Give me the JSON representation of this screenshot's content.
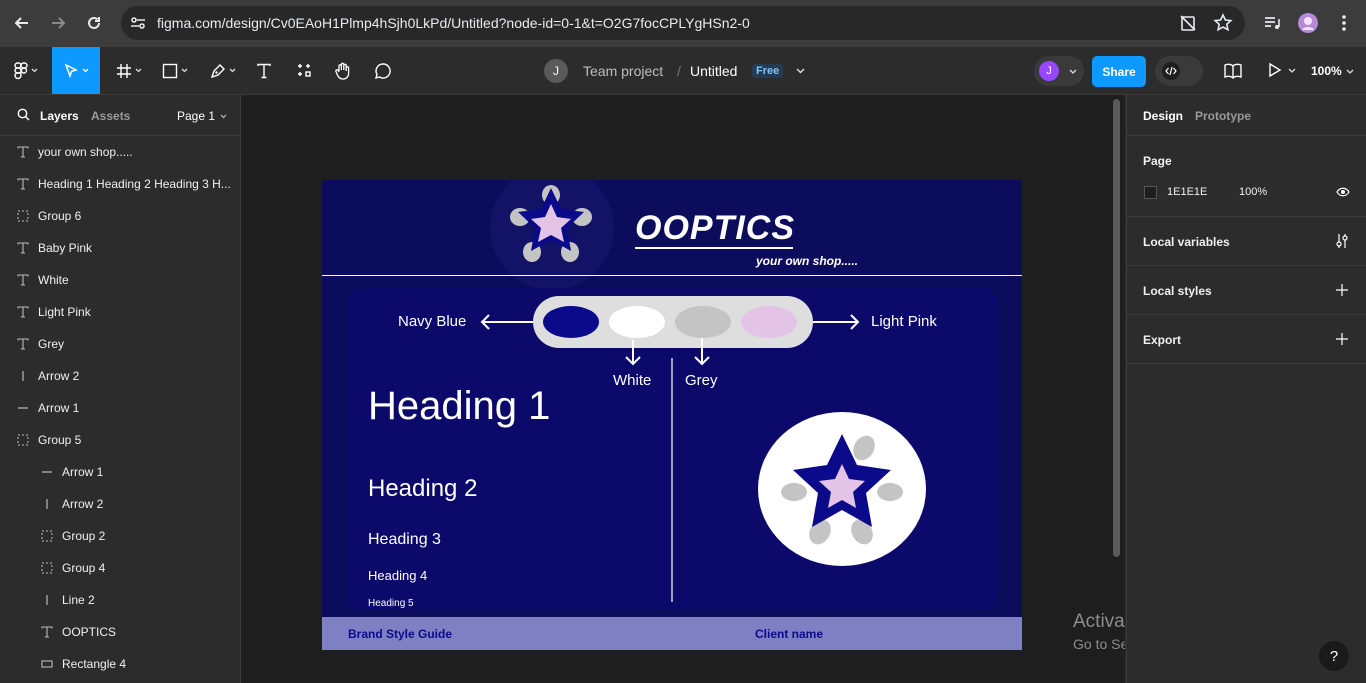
{
  "browser": {
    "url": "figma.com/design/Cv0EAoH1Plmp4hSjh0LkPd/Untitled?node-id=0-1&t=O2G7focCPLYgHSn2-0",
    "icons": [
      "back-icon",
      "forward-icon",
      "reload-icon",
      "site-info-icon",
      "no-tracking-icon",
      "bookmark-star-icon",
      "media-icon",
      "profile-icon",
      "menu-icon"
    ]
  },
  "toolbar": {
    "team_initial": "J",
    "team": "Team project",
    "separator": "/",
    "file": "Untitled",
    "plan_badge": "Free",
    "user_initial": "J",
    "share": "Share",
    "zoom": "100%"
  },
  "left_panel": {
    "tab_layers": "Layers",
    "tab_assets": "Assets",
    "page": "Page 1",
    "layers": [
      {
        "name": "your own shop.....",
        "icon": "text-icon",
        "indent": 0
      },
      {
        "name": "Heading 1 Heading 2 Heading 3 H...",
        "icon": "text-icon",
        "indent": 0
      },
      {
        "name": "Group 6",
        "icon": "group-icon",
        "indent": 0
      },
      {
        "name": "Baby Pink",
        "icon": "text-icon",
        "indent": 0
      },
      {
        "name": "White",
        "icon": "text-icon",
        "indent": 0
      },
      {
        "name": "Light Pink",
        "icon": "text-icon",
        "indent": 0
      },
      {
        "name": "Grey",
        "icon": "text-icon",
        "indent": 0
      },
      {
        "name": "Arrow 2",
        "icon": "vline-icon",
        "indent": 0
      },
      {
        "name": "Arrow 1",
        "icon": "hline-icon",
        "indent": 0
      },
      {
        "name": "Group 5",
        "icon": "group-icon",
        "indent": 0
      },
      {
        "name": "Arrow 1",
        "icon": "hline-icon",
        "indent": 1
      },
      {
        "name": "Arrow 2",
        "icon": "vline-icon",
        "indent": 1
      },
      {
        "name": "Group 2",
        "icon": "group-icon",
        "indent": 1
      },
      {
        "name": "Group 4",
        "icon": "group-icon",
        "indent": 1
      },
      {
        "name": "Line 2",
        "icon": "vline-icon",
        "indent": 1
      },
      {
        "name": "OOPTICS",
        "icon": "text-icon",
        "indent": 1
      },
      {
        "name": "Rectangle 4",
        "icon": "rect-icon",
        "indent": 1
      }
    ]
  },
  "design": {
    "brand": "OOPTICS",
    "tagline": "your own shop.....",
    "palette_labels": {
      "navy": "Navy Blue",
      "white": "White",
      "grey": "Grey",
      "light_pink": "Light Pink"
    },
    "headings": [
      "Heading 1",
      "Heading 2",
      "Heading 3",
      "Heading 4",
      "Heading 5"
    ],
    "footer_left": "Brand Style Guide",
    "footer_right": "Client name",
    "colors": {
      "navy": "#0b0a8a",
      "background": "#0c0c5c",
      "white": "#ffffff",
      "grey": "#c4c4c4",
      "light_pink": "#e3c4e6",
      "footer": "#7f7fc4"
    }
  },
  "right_panel": {
    "tab_design": "Design",
    "tab_prototype": "Prototype",
    "page_label": "Page",
    "page_color": "1E1E1E",
    "page_opacity": "100%",
    "local_variables": "Local variables",
    "local_styles": "Local styles",
    "export": "Export"
  },
  "watermark": {
    "title": "Activate Windows",
    "subtitle": "Go to Settings to activate Windows."
  },
  "help": "?"
}
